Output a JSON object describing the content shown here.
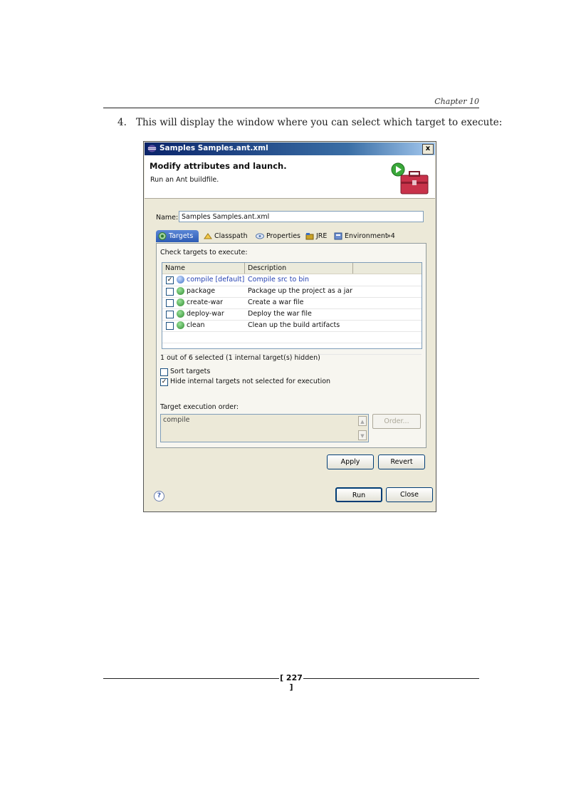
{
  "page": {
    "chapter": "Chapter 10",
    "step_number": "4.",
    "step_text": "This will display the window where you can select which target to execute:",
    "page_number": "[ 227 ]"
  },
  "dialog": {
    "title": "Samples Samples.ant.xml",
    "close_glyph": "x",
    "banner_title": "Modify attributes and launch.",
    "banner_subtitle": "Run an Ant buildfile.",
    "name_label": "Name:",
    "name_value": "Samples Samples.ant.xml",
    "tabs": [
      {
        "label": "Targets",
        "icon": "targets-icon"
      },
      {
        "label": "Classpath",
        "icon": "classpath-icon"
      },
      {
        "label": "Properties",
        "icon": "properties-icon"
      },
      {
        "label": "JRE",
        "icon": "jre-icon"
      },
      {
        "label": "Environment",
        "icon": "environment-icon"
      }
    ],
    "more_tabs": "»4",
    "check_label": "Check targets to execute:",
    "columns": [
      "Name",
      "Description"
    ],
    "targets": [
      {
        "name": "compile [default]",
        "description": "Compile src to bin",
        "checked": true
      },
      {
        "name": "package",
        "description": "Package up the project as a jar",
        "checked": false
      },
      {
        "name": "create-war",
        "description": "Create a war file",
        "checked": false
      },
      {
        "name": "deploy-war",
        "description": "Deploy the war file",
        "checked": false
      },
      {
        "name": "clean",
        "description": "Clean up the build artifacts",
        "checked": false
      }
    ],
    "status": "1 out of 6 selected (1 internal target(s) hidden)",
    "sort_targets": {
      "label": "Sort targets",
      "checked": false
    },
    "hide_internal": {
      "label": "Hide internal targets not selected for execution",
      "checked": true
    },
    "order_label": "Target execution order:",
    "order_value": "compile",
    "order_button": "Order...",
    "apply_button": "Apply",
    "revert_button": "Revert",
    "run_button": "Run",
    "close_button": "Close",
    "help_glyph": "?",
    "check_glyph": "✓",
    "colors": {
      "title_bar": "#0a246a",
      "active_tab": "#2d5bb4",
      "default_target": "#2541b2"
    }
  }
}
